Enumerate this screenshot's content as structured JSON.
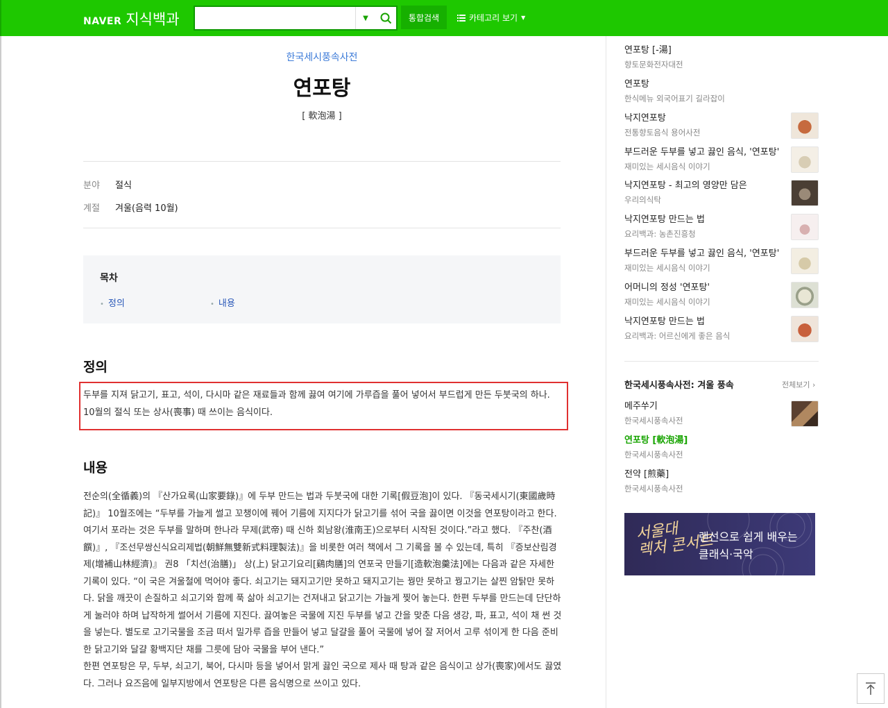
{
  "header": {
    "brand": "NAVER",
    "service": "지식백과",
    "search_value": "",
    "total_search_label": "통합검색",
    "category_label": "카테고리 보기"
  },
  "article": {
    "source": "한국세시풍속사전",
    "title": "연포탕",
    "hanja": "[ 軟泡湯 ]",
    "meta": [
      {
        "label": "분야",
        "value": "절식"
      },
      {
        "label": "계절",
        "value": "겨울(음력 10월)"
      }
    ],
    "toc": {
      "title": "목차",
      "items": [
        "정의",
        "내용"
      ]
    },
    "definition_title": "정의",
    "definition_text": "두부를 지져 닭고기, 표고, 석이, 다시마 같은 재료들과 함께 끓여 여기에 가루즙을 풀어 넣어서 부드럽게 만든 두붓국의 하나. 10월의 절식 또는 상사(喪事) 때 쓰이는 음식이다.",
    "content_title": "내용",
    "content_text": "전순의(全循義)의 『산가요록(山家要錄)』에 두부 만드는 법과 두붓국에 대한 기록[假豆泡]이 있다. 『동국세시기(東國歲時記)』 10월조에는 “두부를 가늘게 썰고 꼬챙이에 꿰어 기름에 지지다가 닭고기를 섞어 국을 끓이면 이것을 연포탕이라고 한다. 여기서 포라는 것은 두부를 말하며 한나라 무제(武帝) 때 신하 회남왕(淮南王)으로부터 시작된 것이다.”라고 했다. 『주찬(酒饌)』, 『조선무쌍신식요리제법(朝鮮無雙新式料理製法)』을 비롯한 여러 책에서 그 기록을 볼 수 있는데, 특히 『증보산림경제(增補山林經濟)』 권8 「치선(治膳)」 상(上) 닭고기요리[鷄肉膳]의 연포국 만들기[造軟泡羹法]에는 다음과 같은 자세한 기록이 있다. “이 국은 겨울철에 먹어야 좋다. 쇠고기는 돼지고기만 못하고 돼지고기는 꿩만 못하고 꿩고기는 살찐 암탉만 못하다. 닭을 깨끗이 손질하고 쇠고기와 함께 푹 삶아 쇠고기는 건져내고 닭고기는 가늘게 찢어 놓는다. 한편 두부를 만드는데 단단하게 눌러야 하며 납작하게 썰어서 기름에 지진다. 끓여놓은 국물에 지진 두부를 넣고 간을 맞춘 다음 생강, 파, 표고, 석이 채 썬 것을 넣는다. 별도로 고기국물을 조금 떠서 밀가루 즙을 만들어 넣고 달걀을 풀어 국물에 넣어 잘 저어서 고루 섞이게 한 다음 준비한 닭고기와 달걀 황백지단 채를 그릇에 담아 국물을 부어 낸다.”",
    "content_text_2": "한편 연포탕은 무, 두부, 쇠고기, 북어, 다시마 등을 넣어서 맑게 끓인 국으로 제사 때 탕과 같은 음식이고 상가(喪家)에서도 끓였다. 그러나 요즈음에 일부지방에서 연포탕은 다른 음식명으로 쓰이고 있다."
  },
  "sidebar": {
    "related": [
      {
        "title": "연포탕 [-湯]",
        "source": "향토문화전자대전",
        "thumb": false
      },
      {
        "title": "연포탕",
        "source": "한식메뉴 외국어표기 길라잡이",
        "thumb": false
      },
      {
        "title": "낙지연포탕",
        "source": "전통향토음식 용어사전",
        "thumb": true,
        "color": "#d9a07a"
      },
      {
        "title": "부드러운 두부를 넣고 끓인 음식, '연포탕'",
        "source": "재미있는 세시음식 이야기",
        "thumb": true,
        "color": "#e6dcc8"
      },
      {
        "title": "낙지연포탕 - 최고의 영양만 담은",
        "source": "우리의식탁",
        "thumb": true,
        "color": "#6a6050"
      },
      {
        "title": "낙지연포탕 만드는 법",
        "source": "요리백과: 농촌진흥청",
        "thumb": true,
        "color": "#e8d6d6"
      },
      {
        "title": "부드러운 두부를 넣고 끓인 음식, '연포탕'",
        "source": "재미있는 세시음식 이야기",
        "thumb": true,
        "color": "#e0d8c4"
      },
      {
        "title": "어머니의 정성 '연포탕'",
        "source": "재미있는 세시음식 이야기",
        "thumb": true,
        "color": "#c9cfc0"
      },
      {
        "title": "낙지연포탕 만드는 법",
        "source": "요리백과: 어르신에게 좋은 음식",
        "thumb": true,
        "color": "#d99a80"
      }
    ],
    "collection": {
      "title": "한국세시풍속사전: 겨울 풍속",
      "more_label": "전체보기",
      "items": [
        {
          "title": "메주쑤기",
          "source": "한국세시풍속사전",
          "thumb": true,
          "color": "#7a5a40",
          "active": false
        },
        {
          "title": "연포탕 [軟泡湯]",
          "source": "한국세시풍속사전",
          "thumb": false,
          "active": true
        },
        {
          "title": "전약 [煎藥]",
          "source": "한국세시풍속사전",
          "thumb": false,
          "active": false
        }
      ]
    },
    "banner": {
      "logo_line1": "서울대",
      "logo_line2": "렉처 콘서트",
      "text_line1": "랜선으로 쉽게 배우는",
      "text_line2": "클래식·국악"
    }
  },
  "colors": {
    "naver_green": "#1ec800",
    "link_blue": "#2a58b8",
    "highlight_red": "#e03030"
  }
}
